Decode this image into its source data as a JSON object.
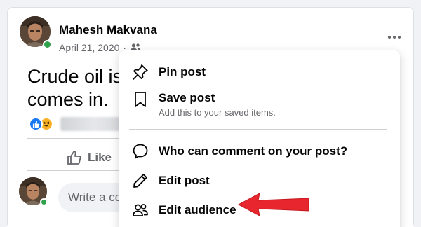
{
  "post": {
    "author_name": "Mahesh Makvana",
    "date": "April 21, 2020",
    "separator": "·",
    "text": "Crude oil is comes in.",
    "like_label": "Like",
    "comment_placeholder": "Write a comment..."
  },
  "menu": {
    "items": [
      {
        "label": "Pin post",
        "icon": "pin-icon"
      },
      {
        "label": "Save post",
        "sublabel": "Add this to your saved items.",
        "icon": "bookmark-icon"
      },
      {
        "label": "Who can comment on your post?",
        "icon": "comment-bubble-icon"
      },
      {
        "label": "Edit post",
        "icon": "pencil-icon"
      },
      {
        "label": "Edit audience",
        "icon": "people-icon"
      }
    ]
  },
  "colors": {
    "online": "#31a24c",
    "like_blue": "#1877f2",
    "haha_yellow": "#f7b125",
    "annotation_arrow": "#e8262d",
    "secondary_text": "#65676b"
  }
}
